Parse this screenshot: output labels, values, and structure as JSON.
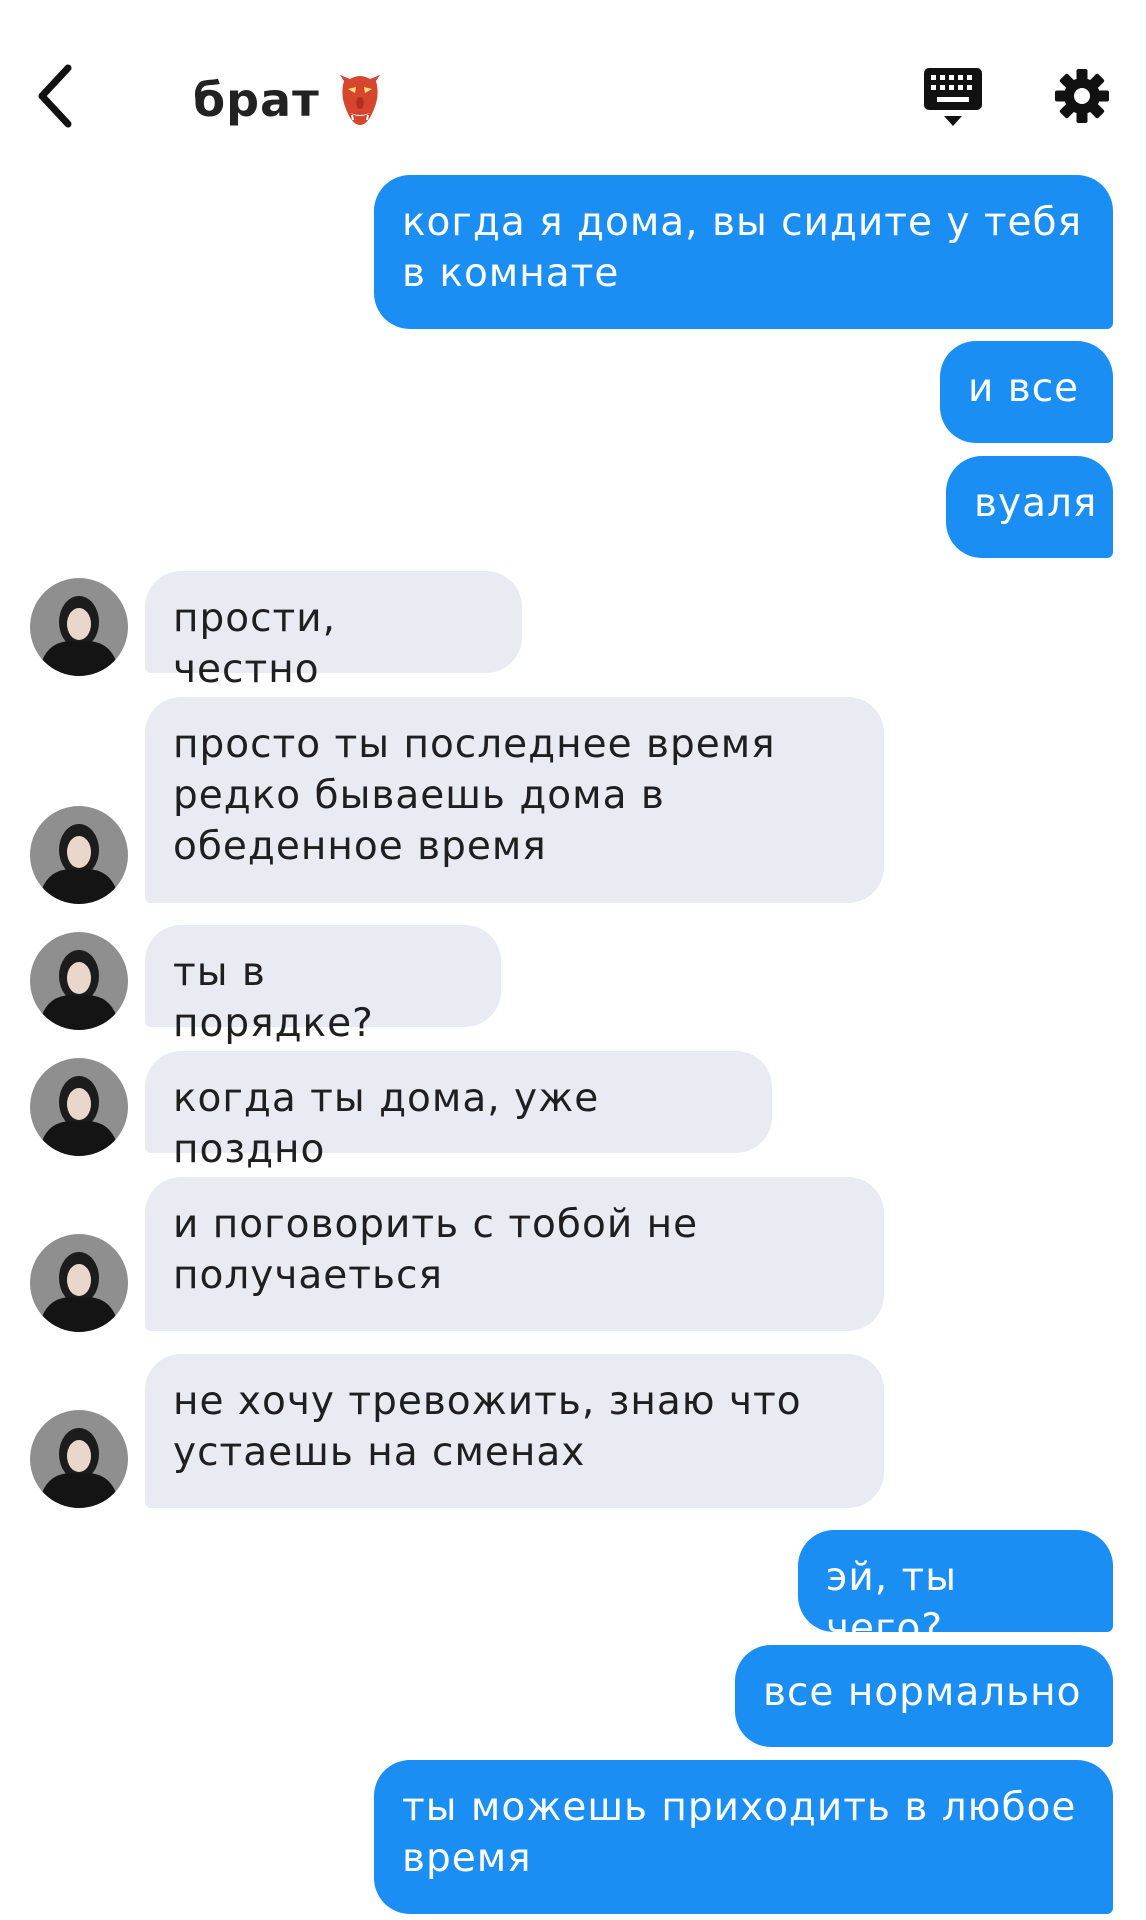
{
  "header": {
    "title": "брат",
    "back_icon": "chevron-left-icon",
    "title_emoji_icon": "goblin-mask-icon",
    "keyboard_icon": "keyboard-icon",
    "settings_icon": "gear-icon"
  },
  "colors": {
    "outgoing_bubble": "#1a8ef3",
    "incoming_bubble": "#e9ebf2",
    "background": "#ffffff"
  },
  "messages": [
    {
      "side": "out",
      "text": "когда я дома, вы сидите у тебя в комнате"
    },
    {
      "side": "out",
      "text": "и все"
    },
    {
      "side": "out",
      "text": "вуаля"
    },
    {
      "side": "in",
      "text": "прости, честно"
    },
    {
      "side": "in",
      "text": "просто ты последнее время редко бываешь дома в обеденное время"
    },
    {
      "side": "in",
      "text": "ты в порядке?"
    },
    {
      "side": "in",
      "text": "когда ты дома, уже поздно"
    },
    {
      "side": "in",
      "text": "и поговорить с тобой не получаеться"
    },
    {
      "side": "in",
      "text": "не хочу тревожить, знаю что устаешь на сменах"
    },
    {
      "side": "out",
      "text": "эй, ты чего?"
    },
    {
      "side": "out",
      "text": "все нормально"
    },
    {
      "side": "out",
      "text": "ты можешь приходить в любое время"
    }
  ]
}
